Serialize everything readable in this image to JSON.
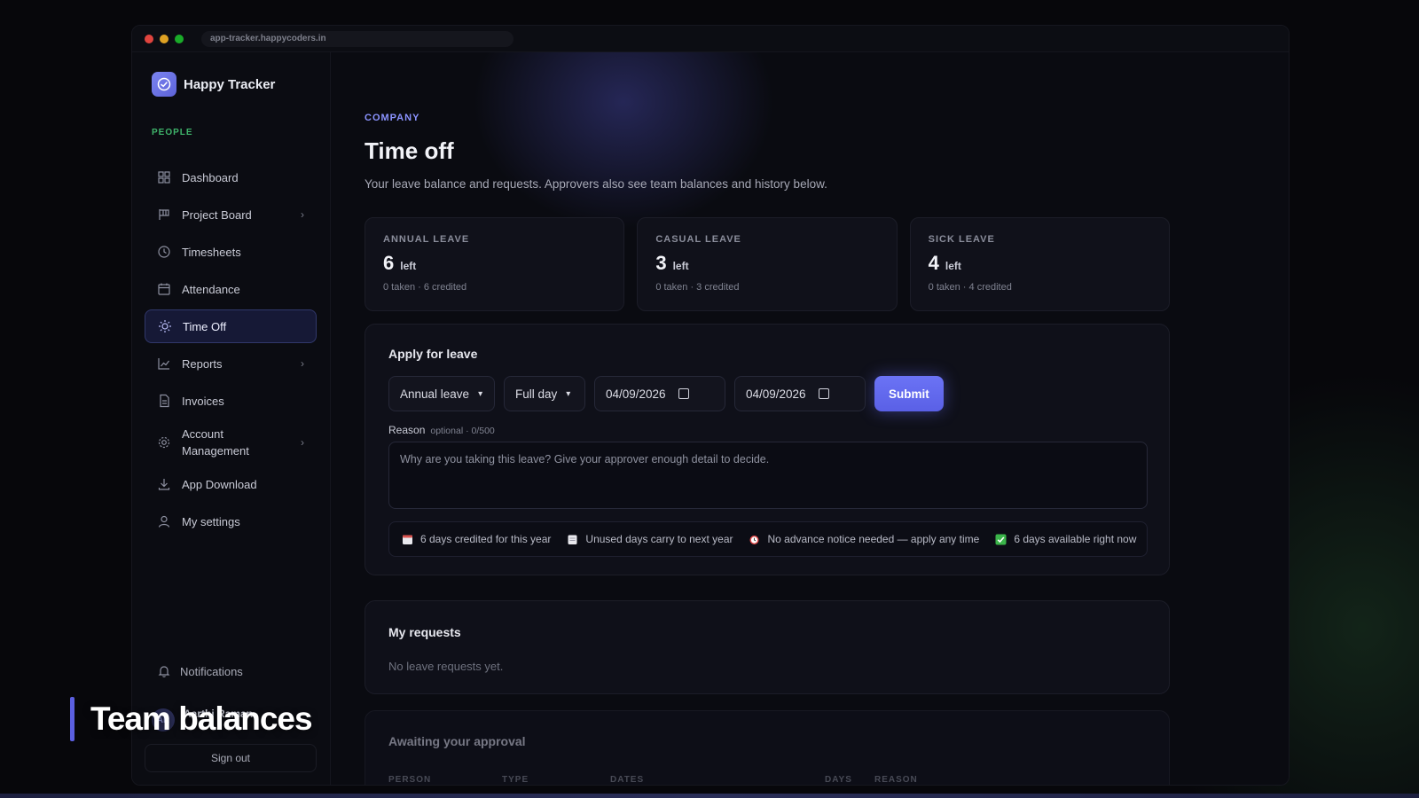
{
  "browser": {
    "url": "app-tracker.happycoders.in",
    "dots": [
      "#e0443e",
      "#dea123",
      "#1aab29"
    ]
  },
  "brand": {
    "name": "Happy Tracker",
    "subtitle": "PEOPLE",
    "accent": "#6b73f5",
    "sub_color": "#3fb56b"
  },
  "sidebar": {
    "items": [
      {
        "label": "Dashboard",
        "icon": "grid-icon",
        "chevron": false
      },
      {
        "label": "Project Board",
        "icon": "board-icon",
        "chevron": true
      },
      {
        "label": "Timesheets",
        "icon": "clock-icon",
        "chevron": false
      },
      {
        "label": "Attendance",
        "icon": "calendar-icon",
        "chevron": false
      },
      {
        "label": "Time Off",
        "icon": "sun-icon",
        "chevron": false,
        "active": true
      },
      {
        "label": "Reports",
        "icon": "chart-icon",
        "chevron": true
      },
      {
        "label": "Invoices",
        "icon": "document-icon",
        "chevron": false
      },
      {
        "label": "Account Management",
        "icon": "gear-icon",
        "chevron": true
      },
      {
        "label": "App Download",
        "icon": "download-icon",
        "chevron": false
      },
      {
        "label": "My settings",
        "icon": "user-icon",
        "chevron": false
      }
    ],
    "notifications": "Notifications",
    "user": {
      "initials": "AR",
      "name": "Aarthi Raman"
    },
    "sign_out": "Sign out"
  },
  "page": {
    "eyebrow": "COMPANY",
    "title": "Time off",
    "subtitle": "Your leave balance and requests. Approvers also see team balances and history below."
  },
  "balances": [
    {
      "label": "ANNUAL LEAVE",
      "value": "6",
      "unit": "left",
      "meta": "0 taken · 6 credited"
    },
    {
      "label": "CASUAL LEAVE",
      "value": "3",
      "unit": "left",
      "meta": "0 taken · 3 credited"
    },
    {
      "label": "SICK LEAVE",
      "value": "4",
      "unit": "left",
      "meta": "0 taken · 4 credited"
    }
  ],
  "apply": {
    "title": "Apply for leave",
    "leave_type": "Annual leave",
    "duration": "Full day",
    "start_date": "04/09/2026",
    "end_date": "04/09/2026",
    "submit": "Submit",
    "reason_label": "Reason",
    "reason_hint": "optional · 0/500",
    "reason_placeholder": "Why are you taking this leave? Give your approver enough detail to decide.",
    "chips": [
      {
        "icon": "calendar-icon",
        "text": "6 days credited for this year"
      },
      {
        "icon": "notepad-icon",
        "text": "Unused days carry to next year"
      },
      {
        "icon": "alarm-clock-icon",
        "text": "No advance notice needed — apply any time"
      },
      {
        "icon": "check-mark-icon",
        "text": "6 days available right now"
      }
    ]
  },
  "my_requests": {
    "title": "My requests",
    "empty": "No leave requests yet."
  },
  "approval": {
    "title": "Awaiting your approval",
    "columns": [
      "PERSON",
      "TYPE",
      "DATES",
      "DAYS",
      "REASON"
    ]
  },
  "overlay": {
    "caption": "Team balances"
  }
}
